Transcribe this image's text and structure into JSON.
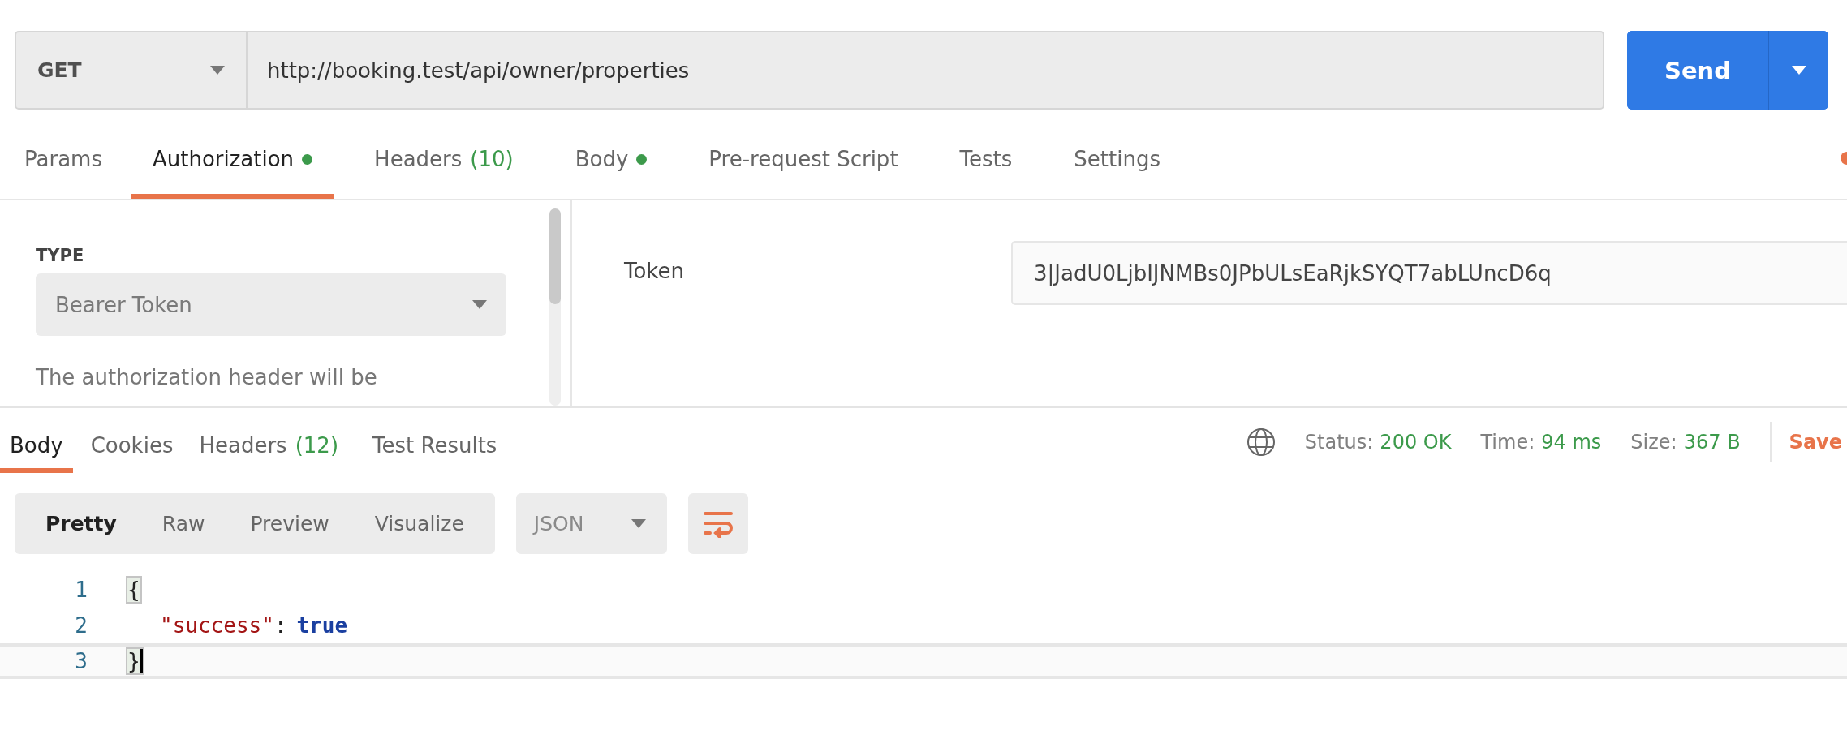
{
  "request": {
    "method": "GET",
    "url": "http://booking.test/api/owner/properties",
    "send": "Send"
  },
  "request_tabs": [
    {
      "label": "Params",
      "selected": false,
      "dot": false
    },
    {
      "label": "Authorization",
      "selected": true,
      "dot": true
    },
    {
      "label": "Headers",
      "count": "(10)",
      "selected": false,
      "dot": false
    },
    {
      "label": "Body",
      "selected": false,
      "dot": true
    },
    {
      "label": "Pre-request Script",
      "selected": false,
      "dot": false
    },
    {
      "label": "Tests",
      "selected": false,
      "dot": false
    },
    {
      "label": "Settings",
      "selected": false,
      "dot": false
    }
  ],
  "auth": {
    "type_label": "TYPE",
    "type_value": "Bearer Token",
    "description": "The authorization header will be",
    "token_label": "Token",
    "token_value": "3|JadU0LjbIJNMBs0JPbULsEaRjkSYQT7abLUncD6q"
  },
  "response_tabs": [
    {
      "label": "Body",
      "selected": true
    },
    {
      "label": "Cookies",
      "selected": false
    },
    {
      "label": "Headers",
      "count": "(12)",
      "selected": false
    },
    {
      "label": "Test Results",
      "selected": false
    }
  ],
  "response_stats": [
    {
      "label": "Status:",
      "value": "200 OK"
    },
    {
      "label": "Time:",
      "value": "94 ms"
    },
    {
      "label": "Size:",
      "value": "367 B"
    }
  ],
  "save": "Save",
  "format_tabs": [
    {
      "label": "Pretty",
      "selected": true
    },
    {
      "label": "Raw",
      "selected": false
    },
    {
      "label": "Preview",
      "selected": false
    },
    {
      "label": "Visualize",
      "selected": false
    }
  ],
  "format": "JSON",
  "code_lines": [
    {
      "number": "1",
      "indent": false,
      "current": false,
      "tokens": [
        {
          "kind": "brace",
          "text": "{",
          "matched": true
        }
      ]
    },
    {
      "number": "2",
      "indent": true,
      "current": false,
      "tokens": [
        {
          "kind": "key",
          "text": "\"success\""
        },
        {
          "kind": "punct",
          "text": ":"
        },
        {
          "kind": "boolean",
          "text": "true"
        }
      ]
    },
    {
      "number": "3",
      "indent": false,
      "current": true,
      "tokens": [
        {
          "kind": "brace",
          "text": "}",
          "matched": true
        }
      ]
    }
  ]
}
